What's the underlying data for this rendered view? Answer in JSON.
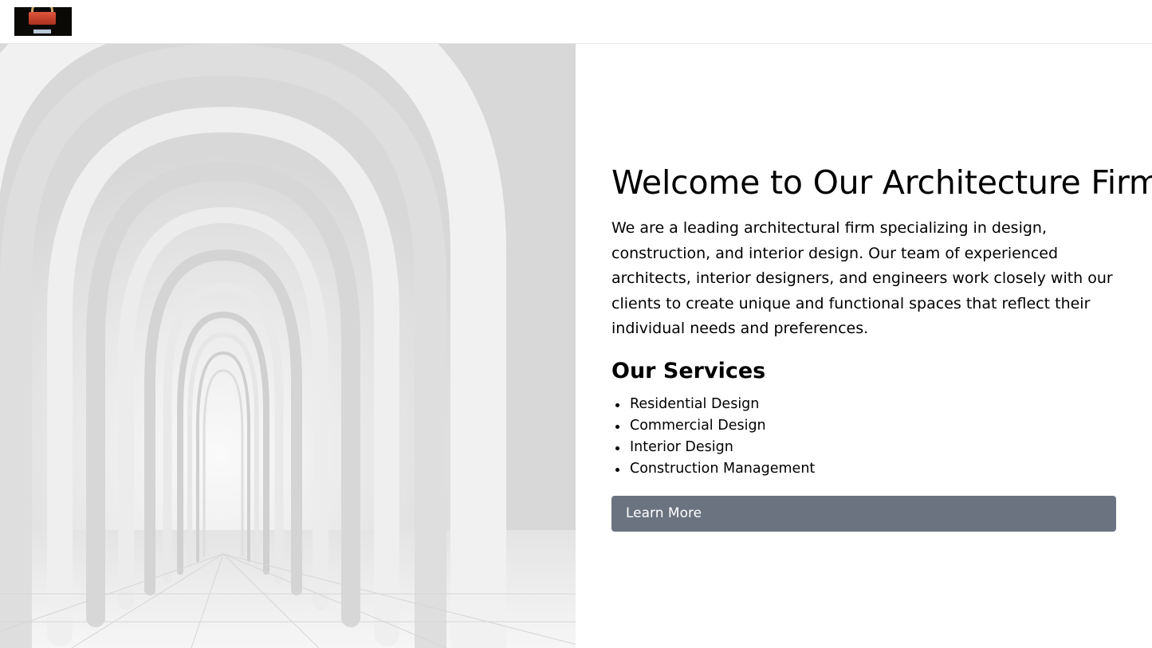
{
  "header": {
    "logo": "shopping-bag-logo"
  },
  "hero": {
    "image": "white-arched-corridor"
  },
  "main": {
    "title": "Welcome to Our Architecture Firm",
    "intro": "We are a leading architectural firm specializing in design, construction, and interior design. Our team of experienced architects, interior designers, and engineers work closely with our clients to create unique and functional spaces that reflect their individual needs and preferences.",
    "services_title": "Our Services",
    "services": [
      "Residential Design",
      "Commercial Design",
      "Interior Design",
      "Construction Management"
    ],
    "cta_label": "Learn More"
  },
  "colors": {
    "button_bg": "#6b7280",
    "button_text": "#ffffff",
    "header_border": "#e5e7eb"
  }
}
